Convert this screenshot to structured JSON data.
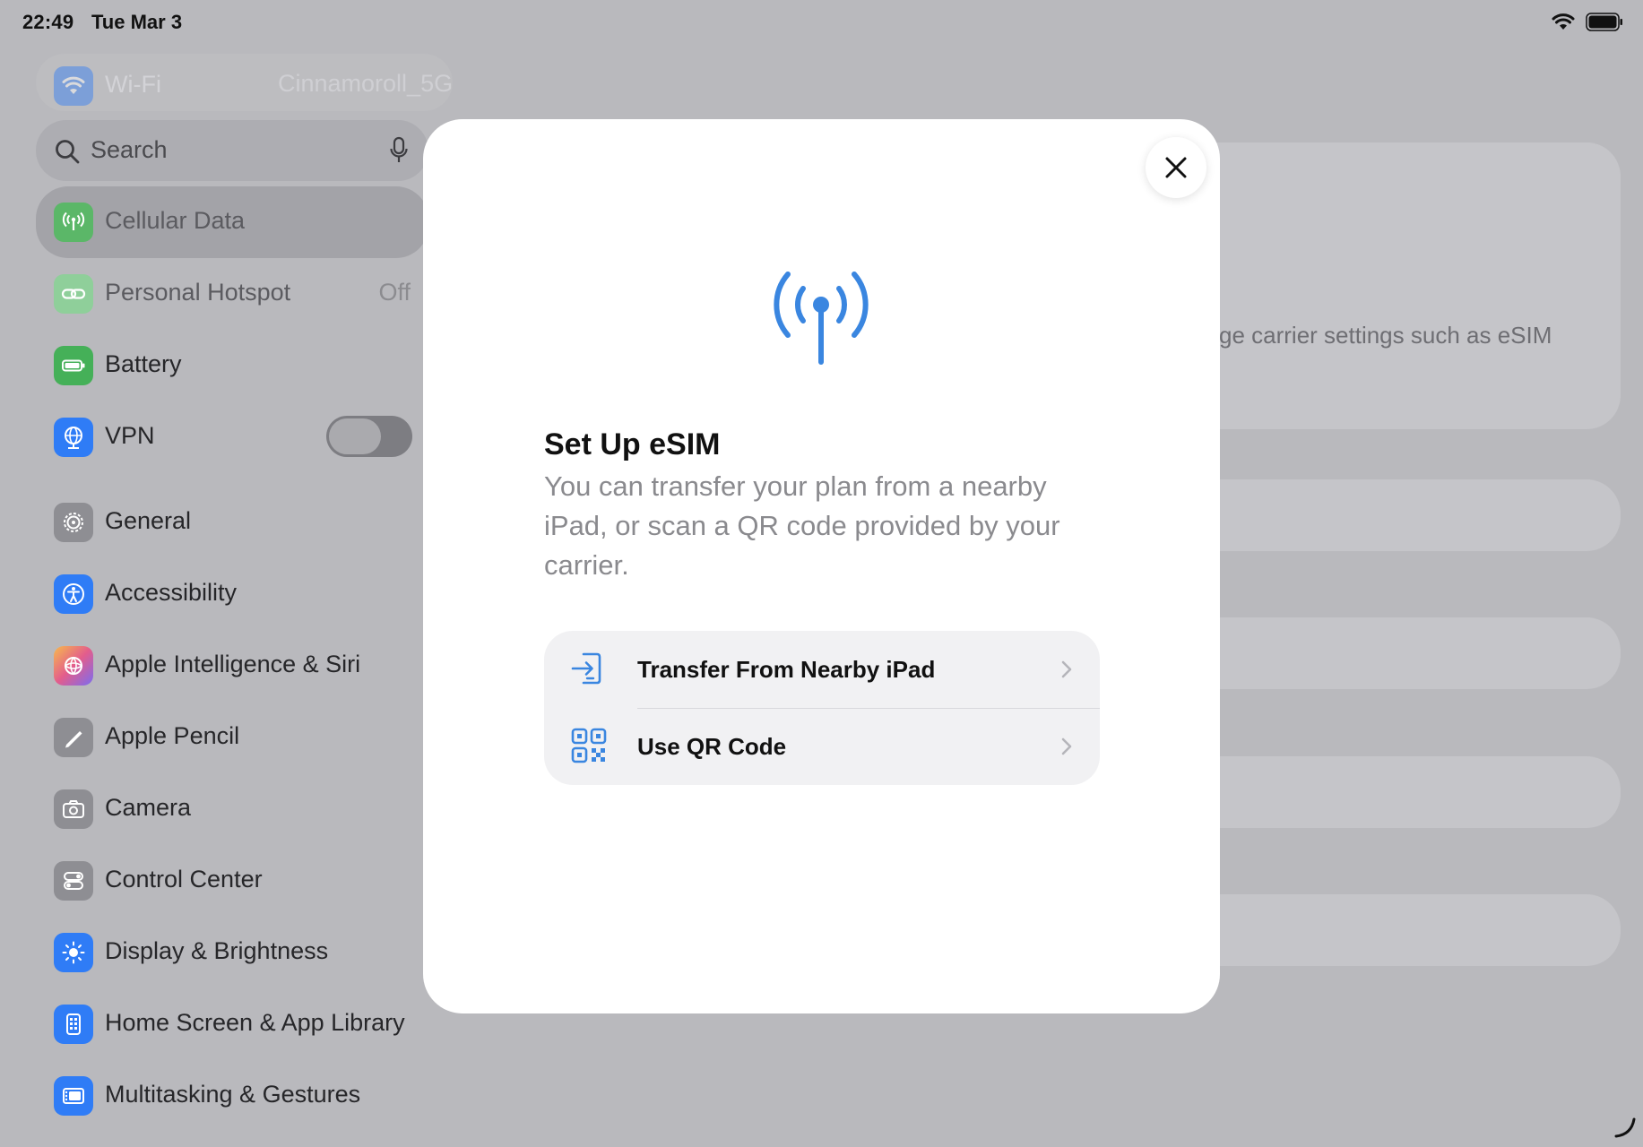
{
  "status_bar": {
    "time": "22:49",
    "date": "Tue Mar 3"
  },
  "sidebar": {
    "wifi": {
      "label": "Wi-Fi",
      "value": "Cinnamoroll_5G"
    },
    "search": {
      "placeholder": "Search"
    },
    "items": [
      {
        "label": "Cellular Data",
        "icon": "antenna-icon",
        "color": "#34c759",
        "selected": true
      },
      {
        "label": "Personal Hotspot",
        "value": "Off",
        "icon": "link-icon",
        "color": "#34c759"
      },
      {
        "label": "Battery",
        "icon": "battery-icon",
        "color": "#34c759"
      },
      {
        "label": "VPN",
        "icon": "globe-icon",
        "color": "#2f7cf6",
        "toggle": "off"
      },
      {
        "label": "General",
        "icon": "gear-icon",
        "color": "#8e8e93"
      },
      {
        "label": "Accessibility",
        "icon": "accessibility-icon",
        "color": "#2f7cf6"
      },
      {
        "label": "Apple Intelligence & Siri",
        "icon": "siri-icon",
        "color": "#e35d8c"
      },
      {
        "label": "Apple Pencil",
        "icon": "pencil-icon",
        "color": "#8e8e93"
      },
      {
        "label": "Camera",
        "icon": "camera-icon",
        "color": "#8e8e93"
      },
      {
        "label": "Control Center",
        "icon": "toggles-icon",
        "color": "#8e8e93"
      },
      {
        "label": "Display & Brightness",
        "icon": "sun-icon",
        "color": "#2f7cf6"
      },
      {
        "label": "Home Screen & App Library",
        "icon": "home-screen-icon",
        "color": "#2f7cf6"
      },
      {
        "label": "Multitasking & Gestures",
        "icon": "multitasking-icon",
        "color": "#2f7cf6"
      }
    ]
  },
  "detail": {
    "partial_text": "ge carrier settings such as eSIM"
  },
  "modal": {
    "title": "Set Up eSIM",
    "description": "You can transfer your plan from a nearby iPad, or scan a QR code provided by your carrier.",
    "options": [
      {
        "label": "Transfer From Nearby iPad",
        "icon": "transfer-icon"
      },
      {
        "label": "Use QR Code",
        "icon": "qr-code-icon"
      }
    ],
    "accent": "#3a86e0"
  }
}
